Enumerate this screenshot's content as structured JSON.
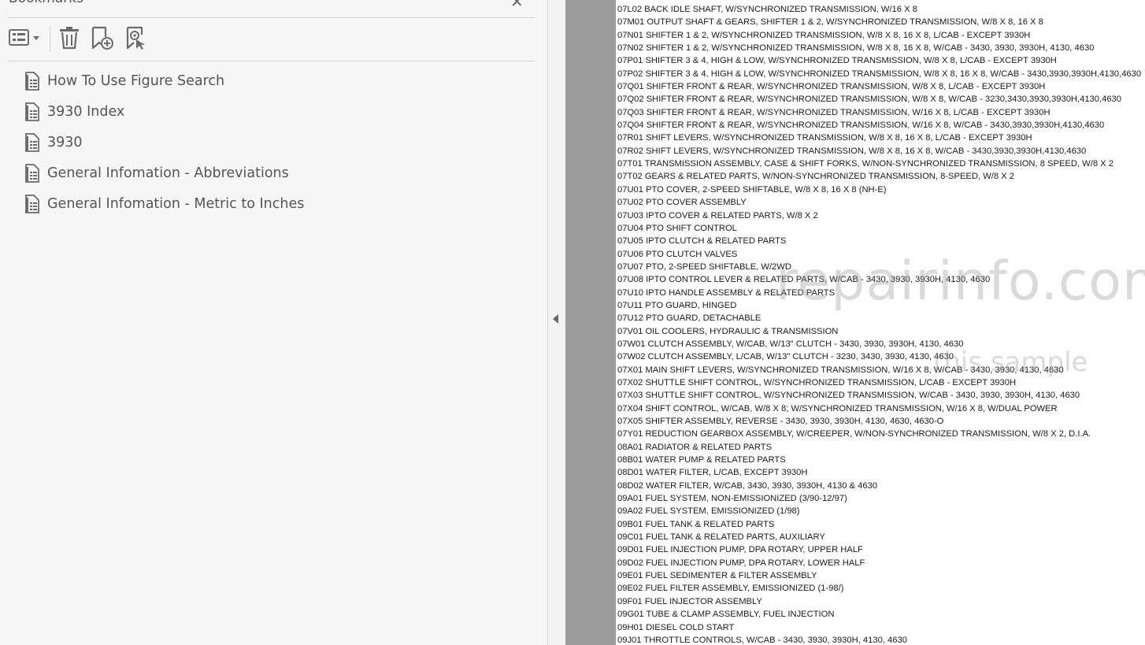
{
  "panel": {
    "title": "Bookmarks",
    "close_glyph": "✕",
    "toolbar": [
      {
        "name": "options-menu-button",
        "icon": "list-options-icon"
      },
      {
        "name": "delete-bookmark-button",
        "icon": "trash-icon"
      },
      {
        "name": "new-bookmark-button",
        "icon": "bookmark-add-icon"
      },
      {
        "name": "find-current-bookmark-button",
        "icon": "bookmark-find-icon"
      }
    ],
    "bookmarks": [
      {
        "label": "How To Use Figure Search",
        "icon": "bookmark-page-icon"
      },
      {
        "label": "3930 Index",
        "icon": "bookmark-page-icon"
      },
      {
        "label": "3930",
        "icon": "bookmark-page-icon"
      },
      {
        "label": "General Infomation - Abbreviations",
        "icon": "bookmark-page-icon"
      },
      {
        "label": "General Infomation - Metric to Inches",
        "icon": "bookmark-page-icon"
      }
    ]
  },
  "document": {
    "lines": [
      "07L02 BACK IDLE SHAFT, W/SYNCHRONIZED TRANSMISSION, W/16 X 8",
      "07M01 OUTPUT SHAFT & GEARS, SHIFTER 1 & 2, W/SYNCHRONIZED TRANSMISSION, W/8 X 8, 16 X 8",
      "07N01 SHIFTER 1 & 2, W/SYNCHRONIZED TRANSMISSION, W/8 X 8, 16 X 8, L/CAB - EXCEPT 3930H",
      "07N02 SHIFTER 1 & 2, W/SYNCHRONIZED TRANSMISSION, W/8 X 8, 16 X 8, W/CAB - 3430, 3930, 3930H, 4130, 4630",
      "07P01 SHIFTER 3 & 4, HIGH & LOW, W/SYNCHRONIZED TRANSMISSION, W/8 X 8, L/CAB - EXCEPT 3930H",
      "07P02 SHIFTER 3 & 4, HIGH & LOW, W/SYNCHRONIZED TRANSMISSION, W/8 X 8, 16 X 8, W/CAB - 3430,3930,3930H,4130,4630",
      "07Q01 SHIFTER FRONT & REAR, W/SYNCHRONIZED TRANSMISSION, W/8 X 8, L/CAB - EXCEPT 3930H",
      "07Q02 SHIFTER FRONT & REAR, W/SYNCHRONIZED TRANSMISSION, W/8 X 8, W/CAB - 3230,3430,3930,3930H,4130,4630",
      "07Q03 SHIFTER FRONT & REAR, W/SYNCHRONIZED TRANSMISSION, W/16 X 8, L/CAB - EXCEPT 3930H",
      "07Q04 SHIFTER FRONT & REAR, W/SYNCHRONIZED TRANSMISSION, W/16 X 8, W/CAB - 3430,3930,3930H,4130,4630",
      "07R01 SHIFT LEVERS, W/SYNCHRONIZED TRANSMISSION, W/8 X 8, 16 X 8, L/CAB - EXCEPT 3930H",
      "07R02 SHIFT LEVERS, W/SYNCHRONIZED TRANSMISSION, W/8 X 8, 16 X 8, W/CAB - 3430,3930,3930H,4130,4630",
      "07T01 TRANSMISSION ASSEMBLY, CASE & SHIFT FORKS, W/NON-SYNCHRONIZED TRANSMISSION, 8 SPEED, W/8 X 2",
      "07T02 GEARS & RELATED PARTS, W/NON-SYNCHRONIZED TRANSMISSION, 8-SPEED, W/8 X 2",
      "07U01 PTO COVER, 2-SPEED SHIFTABLE, W/8 X 8, 16 X 8 (NH-E)",
      "07U02 PTO COVER ASSEMBLY",
      "07U03 IPTO COVER & RELATED PARTS, W/8 X 2",
      "07U04 PTO SHIFT CONTROL",
      "07U05 IPTO CLUTCH & RELATED PARTS",
      "07U06 PTO CLUTCH VALVES",
      "07U07 PTO, 2-SPEED SHIFTABLE, W/2WD",
      "07U08 IPTO CONTROL LEVER & RELATED PARTS, W/CAB - 3430, 3930, 3930H, 4130, 4630",
      "07U10 IPTO HANDLE ASSEMBLY & RELATED PARTS",
      "07U11 PTO GUARD, HINGED",
      "07U12 PTO GUARD, DETACHABLE",
      "07V01 OIL COOLERS, HYDRAULIC & TRANSMISSION",
      "07W01 CLUTCH ASSEMBLY, W/CAB, W/13\" CLUTCH - 3430, 3930, 3930H, 4130, 4630",
      "07W02 CLUTCH ASSEMBLY, L/CAB, W/13\" CLUTCH - 3230, 3430, 3930, 4130, 4630",
      "07X01 MAIN SHIFT LEVERS, W/SYNCHRONIZED TRANSMISSION, W/16 X 8, W/CAB - 3430, 3930, 4130, 4630",
      "07X02 SHUTTLE SHIFT CONTROL, W/SYNCHRONIZED TRANSMISSION, L/CAB - EXCEPT 3930H",
      "07X03 SHUTTLE SHIFT CONTROL, W/SYNCHRONIZED TRANSMISSION, W/CAB - 3430, 3930, 3930H, 4130, 4630",
      "07X04 SHIFT CONTROL, W/CAB, W/8 X 8; W/SYNCHRONIZED TRANSMISSION, W/16 X 8, W/DUAL POWER",
      "07X05 SHIFTER ASSEMBLY, REVERSE - 3430, 3930, 3930H, 4130, 4630, 4630-O",
      "07Y01 REDUCTION GEARBOX ASSEMBLY, W/CREEPER, W/NON-SYNCHRONIZED TRANSMISSION, W/8 X 2, D.I.A.",
      "08A01 RADIATOR & RELATED PARTS",
      "08B01 WATER PUMP & RELATED PARTS",
      "08D01 WATER FILTER, L/CAB, EXCEPT 3930H",
      "08D02 WATER FILTER, W/CAB, 3430, 3930, 3930H, 4130 & 4630",
      "09A01 FUEL SYSTEM, NON-EMISSIONIZED (3/90-12/97)",
      "09A02 FUEL SYSTEM, EMISSIONIZED (1/98)",
      "09B01 FUEL TANK & RELATED PARTS",
      "09C01 FUEL TANK & RELATED PARTS, AUXILIARY",
      "09D01 FUEL INJECTION PUMP, DPA ROTARY, UPPER HALF",
      "09D02 FUEL INJECTION PUMP, DPA ROTARY, LOWER HALF",
      "09E01 FUEL SEDIMENTER & FILTER ASSEMBLY",
      "09E02 FUEL FILTER ASSEMBLY, EMISSIONIZED (1-98/)",
      "09F01 FUEL INJECTOR ASSEMBLY",
      "09G01 TUBE & CLAMP ASSEMBLY, FUEL INJECTION",
      "09H01 DIESEL COLD START",
      "09J01 THROTTLE CONTROLS, W/CAB - 3430, 3930, 3930H, 4130, 4630"
    ]
  },
  "watermark": {
    "line1": "repairinfo.com",
    "line2": "this sample"
  },
  "colors": {
    "panel_bg": "#f6f6f6",
    "icon_gray": "#6b6b6b",
    "viewer_gray": "#9c9c9c",
    "page_bg": "#ffffff"
  }
}
